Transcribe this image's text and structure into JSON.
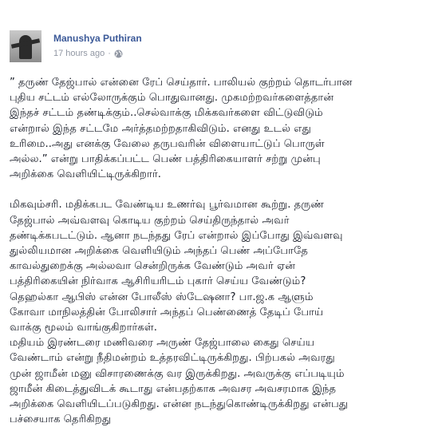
{
  "post": {
    "author": "Manushya Puthiran",
    "timestamp": "17 hours ago",
    "separator": "·",
    "audience_icon": "public-globe-icon",
    "paragraphs": [
      [
        "” தருண் தேஜ்பால் என்னை ரேப் செய்தார். பாலியல் குற்றம் தொடர்பான",
        "புதிய சட்டம் எல்லோருக்கும் பொதுவானது. முகமற்றவர்களைத்தான்",
        "இந்தச் சட்டம் தண்டிக்கும்..செல்வாக்கு மிக்கவர்களை விட்டுவிடும்",
        "என்றால் இந்த சட்டமே அர்த்தமற்றதாகிவிடும். எனது உடல் எது",
        "உரிமை..அது எனக்கு வேலை தருபவரின் விளையாட்டுப் பொருள்",
        "அல்ல.” என்று பாதிக்கப்பட்ட பெண் பத்திரிகையாளர் சற்று முன்பு",
        "அறிக்கை வெளியிட்டிருக்கிறார்."
      ],
      [
        "மிகவும்சரி. மதிக்கபட வேண்டிய உணர்வு பூர்வமான கூற்று. தருண்",
        "தேஜ்பால் அவ்வளவு கொடிய குற்றம் செய்திருந்தால் அவர்",
        "தண்டிக்கபடட்டும். ஆனா நடந்தது ரேப் என்றால் இப்போது இவ்வளவு",
        "துல்லியமான அறிக்கை வெளியிடும் அந்தப் பெண் அப்போதே",
        "காவல்துறைக்கு அல்லவா சென்றிருக்க வேண்டும் அவர் ஏன்",
        "பத்திரிகையின் நிர்வாக ஆசிரியரிடம் புகார் செய்ய வேண்டும்?",
        "தெஹல்கா ஆபிஸ் என்ன போலீஸ் ஸ்டேஷனா? பா.ஜ.க ஆளும்",
        "கோவா மாநிலத்தின் போலிசார் அந்தப் பெண்ணைத் தேடிப் போய்",
        "வாக்கு மூலம் வாங்குகிறார்கள்.",
        "மதியம் இரண்டரை மணிவரை அருண் தேஜ்பாலை கைது செய்ய",
        "வேண்டாம் என்று நீதிமன்றம் உத்தரவிட்டிருக்கிறது. பிற்பகல் அவரது",
        "முன் ஜாமீன் மனு விசாரணைக்கு வர இருக்கிறது. அவருக்கு எப்படியும்",
        "ஜாமீன் கிடைத்துவிடக் கூடாது என்பதற்காக அவசர அவசரமாக இந்த",
        "அறிக்கை வெளியிடப்படுகிறது. என்ன நடந்துகொண்டிருக்கிறது என்பது",
        "பச்சையாக தெரிகிறது"
      ]
    ]
  }
}
